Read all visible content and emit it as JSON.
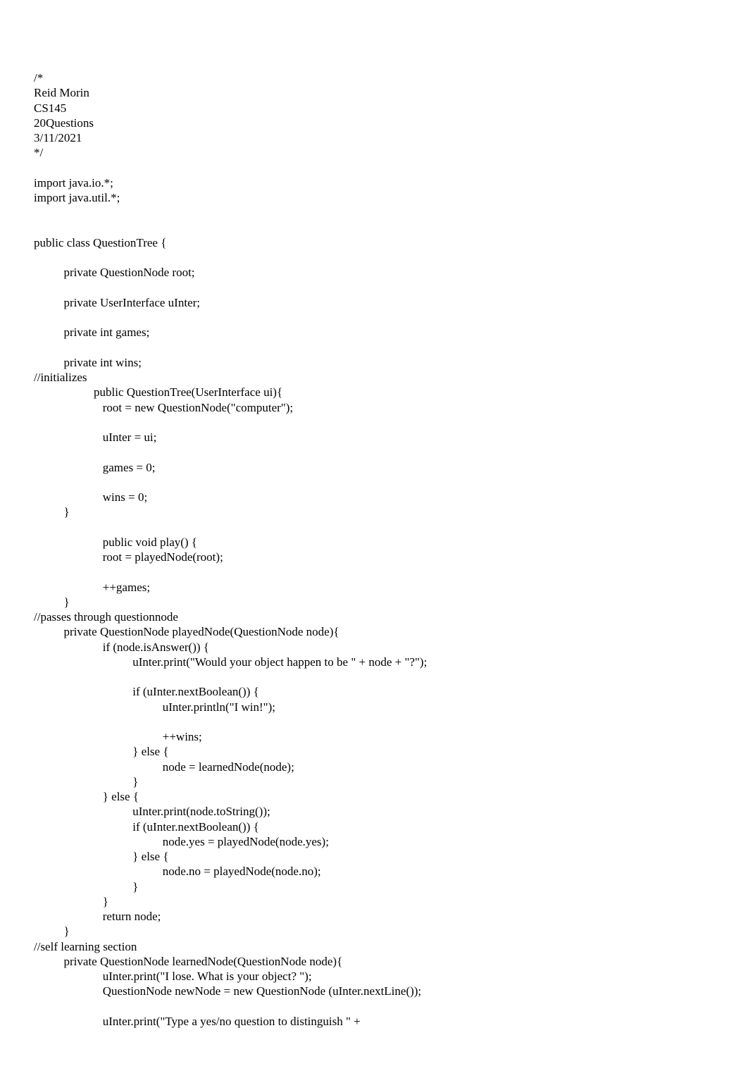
{
  "code": "/*\nReid Morin\nCS145\n20Questions\n3/11/2021\n*/\n\nimport java.io.*;\nimport java.util.*;\n\n\npublic class QuestionTree {\n\n          private QuestionNode root;\n\n          private UserInterface uInter;\n\n          private int games;\n\n          private int wins;\n//initializes\n                    public QuestionTree(UserInterface ui){\n                       root = new QuestionNode(\"computer\");\n\n                       uInter = ui;\n\n                       games = 0;\n\n                       wins = 0;\n          }\n\n                       public void play() {\n                       root = playedNode(root);\n\n                       ++games;\n          }\n//passes through questionnode\n          private QuestionNode playedNode(QuestionNode node){\n                       if (node.isAnswer()) {\n                                 uInter.print(\"Would your object happen to be \" + node + \"?\");\n\n                                 if (uInter.nextBoolean()) {\n                                           uInter.println(\"I win!\");\n\n                                           ++wins;\n                                 } else {\n                                           node = learnedNode(node);\n                                 }\n                       } else {\n                                 uInter.print(node.toString());\n                                 if (uInter.nextBoolean()) {\n                                           node.yes = playedNode(node.yes);\n                                 } else {\n                                           node.no = playedNode(node.no);\n                                 }\n                       }\n                       return node;\n          }\n//self learning section\n          private QuestionNode learnedNode(QuestionNode node){\n                       uInter.print(\"I lose. What is your object? \");\n                       QuestionNode newNode = new QuestionNode (uInter.nextLine());\n\n                       uInter.print(\"Type a yes/no question to distinguish \" +"
}
